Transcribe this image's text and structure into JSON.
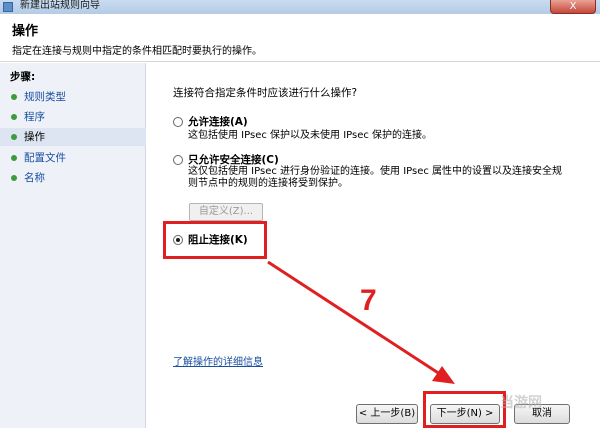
{
  "window": {
    "title": "新建出站规则向导",
    "close_label": "X"
  },
  "header": {
    "title": "操作",
    "subtitle": "指定在连接与规则中指定的条件相匹配时要执行的操作。"
  },
  "sidebar": {
    "steps_label": "步骤:",
    "items": [
      {
        "label": "规则类型",
        "active": false
      },
      {
        "label": "程序",
        "active": false
      },
      {
        "label": "操作",
        "active": true
      },
      {
        "label": "配置文件",
        "active": false
      },
      {
        "label": "名称",
        "active": false
      }
    ]
  },
  "main": {
    "question": "连接符合指定条件时应该进行什么操作?",
    "options": [
      {
        "label": "允许连接(A)",
        "desc": "这包括使用 IPsec 保护以及未使用 IPsec 保护的连接。",
        "checked": false
      },
      {
        "label": "只允许安全连接(C)",
        "desc": "这仅包括使用 IPsec 进行身份验证的连接。使用 IPsec 属性中的设置以及连接安全规则节点中的规则的连接将受到保护。",
        "checked": false
      },
      {
        "label": "阻止连接(K)",
        "desc": "",
        "checked": true
      }
    ],
    "customize_label": "自定义(Z)...",
    "link_label": "了解操作的详细信息"
  },
  "footer": {
    "back_label": "< 上一步(B)",
    "next_label": "下一步(N) >",
    "cancel_label": "取消"
  },
  "annotation": {
    "step_number": "7",
    "color": "#e02020"
  },
  "watermark": {
    "text": "当游网"
  }
}
